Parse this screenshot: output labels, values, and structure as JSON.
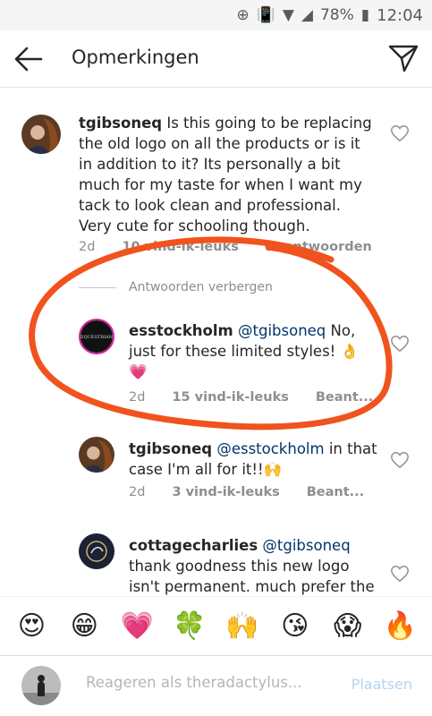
{
  "status_bar": {
    "battery_percent": "78%",
    "time": "12:04"
  },
  "header": {
    "title": "Opmerkingen"
  },
  "comments": [
    {
      "username": "tgibsoneq",
      "mention": "",
      "text": "Is this going to be replacing the old logo on all the products or is it in addition to it? Its personally a bit much for my taste for when I want my tack to look clean and professional. Very cute for schooling though.",
      "age": "2d",
      "likes": "10 vind-ik-leuks",
      "reply_label": "Beantwoorden"
    },
    {
      "username": "esstockholm",
      "mention": "@tgibsoneq",
      "text": "No, just for these limited styles! 👌 💗",
      "age": "2d",
      "likes": "15 vind-ik-leuks",
      "reply_label": "Beant..."
    },
    {
      "username": "tgibsoneq",
      "mention": "@esstockholm",
      "text": "in that case I'm all for it!!🙌",
      "age": "2d",
      "likes": "3 vind-ik-leuks",
      "reply_label": "Beant..."
    },
    {
      "username": "cottagecharlies",
      "mention": "@tgibsoneq",
      "text": "thank goodness this new logo isn't permanent. much prefer the",
      "age": "",
      "likes": "",
      "reply_label": ""
    }
  ],
  "hide_replies_label": "Antwoorden verbergen",
  "emoji_bar": [
    "😍",
    "😁",
    "💗",
    "🍀",
    "🙌",
    "😘",
    "😱",
    "🔥"
  ],
  "input": {
    "placeholder": "Reageren als theradactylus...",
    "post_label": "Plaatsen"
  },
  "colors": {
    "annotation": "#f0531e",
    "mention": "#003569",
    "meta": "#8e8e8e",
    "post_disabled": "#b3d4f3"
  }
}
